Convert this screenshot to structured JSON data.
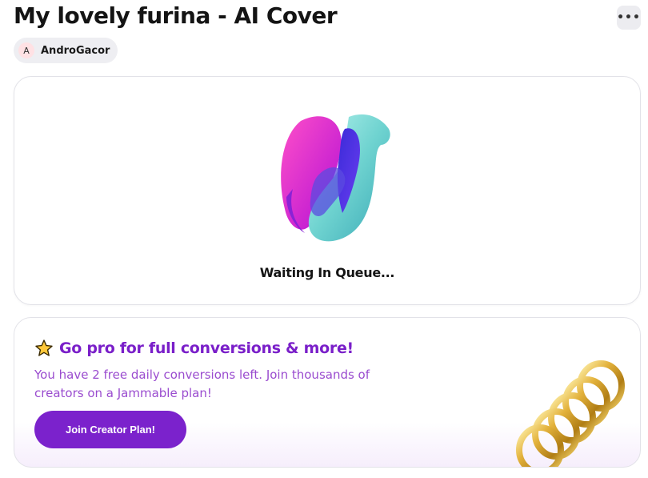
{
  "header": {
    "title": "My lovely furina - AI Cover",
    "more_label": "•••"
  },
  "author": {
    "avatar_initial": "A",
    "name": "AndroGacor"
  },
  "queue": {
    "status": "Waiting In Queue..."
  },
  "promo": {
    "icon": "star-icon",
    "title": "Go pro for full conversions & more!",
    "description": "You have 2 free daily conversions left. Join thousands of creators on a Jammable plan!",
    "button_label": "Join Creator Plan!"
  },
  "colors": {
    "accent": "#7b22cc",
    "promo_text": "#9a4ccf"
  }
}
